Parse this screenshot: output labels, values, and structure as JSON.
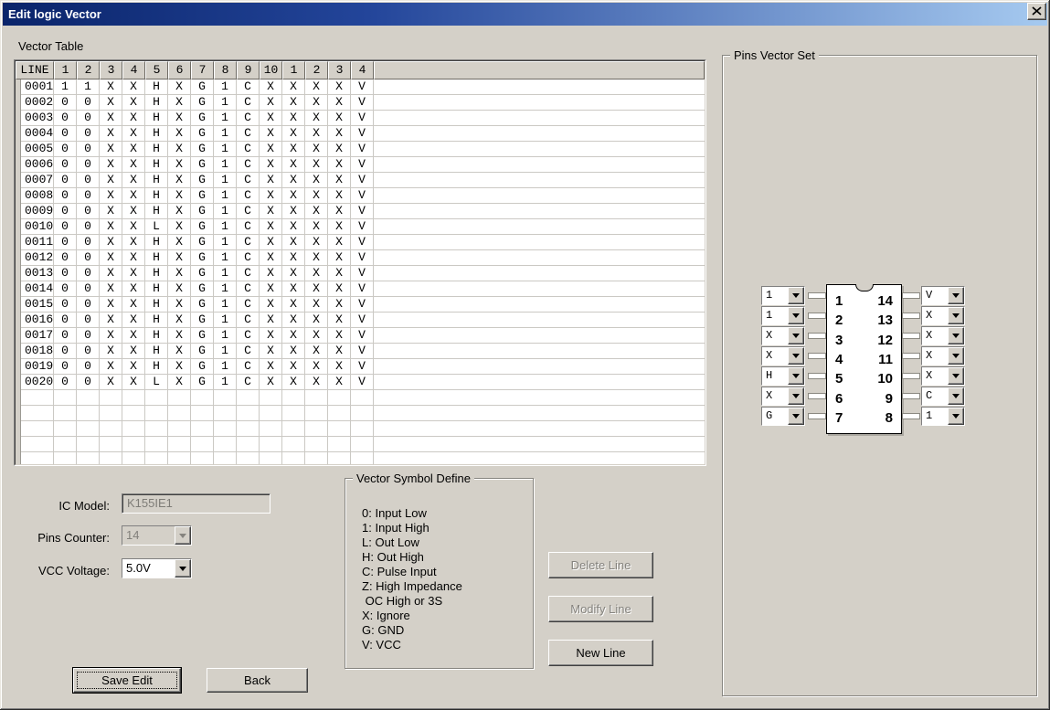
{
  "window": {
    "title": "Edit logic Vector"
  },
  "colors": {
    "dialog_bg": "#d4d0c8",
    "titlebar_start": "#0a246a",
    "titlebar_end": "#a6caf0",
    "grid_line": "#cbc9c4"
  },
  "vector_table": {
    "label": "Vector Table",
    "headers": [
      "LINE",
      "1",
      "2",
      "3",
      "4",
      "5",
      "6",
      "7",
      "8",
      "9",
      "10",
      "1",
      "2",
      "3",
      "4"
    ],
    "rows": [
      {
        "line": "0001",
        "values": [
          "1",
          "1",
          "X",
          "X",
          "H",
          "X",
          "G",
          "1",
          "C",
          "X",
          "X",
          "X",
          "X",
          "V"
        ]
      },
      {
        "line": "0002",
        "values": [
          "0",
          "0",
          "X",
          "X",
          "H",
          "X",
          "G",
          "1",
          "C",
          "X",
          "X",
          "X",
          "X",
          "V"
        ]
      },
      {
        "line": "0003",
        "values": [
          "0",
          "0",
          "X",
          "X",
          "H",
          "X",
          "G",
          "1",
          "C",
          "X",
          "X",
          "X",
          "X",
          "V"
        ]
      },
      {
        "line": "0004",
        "values": [
          "0",
          "0",
          "X",
          "X",
          "H",
          "X",
          "G",
          "1",
          "C",
          "X",
          "X",
          "X",
          "X",
          "V"
        ]
      },
      {
        "line": "0005",
        "values": [
          "0",
          "0",
          "X",
          "X",
          "H",
          "X",
          "G",
          "1",
          "C",
          "X",
          "X",
          "X",
          "X",
          "V"
        ]
      },
      {
        "line": "0006",
        "values": [
          "0",
          "0",
          "X",
          "X",
          "H",
          "X",
          "G",
          "1",
          "C",
          "X",
          "X",
          "X",
          "X",
          "V"
        ]
      },
      {
        "line": "0007",
        "values": [
          "0",
          "0",
          "X",
          "X",
          "H",
          "X",
          "G",
          "1",
          "C",
          "X",
          "X",
          "X",
          "X",
          "V"
        ]
      },
      {
        "line": "0008",
        "values": [
          "0",
          "0",
          "X",
          "X",
          "H",
          "X",
          "G",
          "1",
          "C",
          "X",
          "X",
          "X",
          "X",
          "V"
        ]
      },
      {
        "line": "0009",
        "values": [
          "0",
          "0",
          "X",
          "X",
          "H",
          "X",
          "G",
          "1",
          "C",
          "X",
          "X",
          "X",
          "X",
          "V"
        ]
      },
      {
        "line": "0010",
        "values": [
          "0",
          "0",
          "X",
          "X",
          "L",
          "X",
          "G",
          "1",
          "C",
          "X",
          "X",
          "X",
          "X",
          "V"
        ]
      },
      {
        "line": "0011",
        "values": [
          "0",
          "0",
          "X",
          "X",
          "H",
          "X",
          "G",
          "1",
          "C",
          "X",
          "X",
          "X",
          "X",
          "V"
        ]
      },
      {
        "line": "0012",
        "values": [
          "0",
          "0",
          "X",
          "X",
          "H",
          "X",
          "G",
          "1",
          "C",
          "X",
          "X",
          "X",
          "X",
          "V"
        ]
      },
      {
        "line": "0013",
        "values": [
          "0",
          "0",
          "X",
          "X",
          "H",
          "X",
          "G",
          "1",
          "C",
          "X",
          "X",
          "X",
          "X",
          "V"
        ]
      },
      {
        "line": "0014",
        "values": [
          "0",
          "0",
          "X",
          "X",
          "H",
          "X",
          "G",
          "1",
          "C",
          "X",
          "X",
          "X",
          "X",
          "V"
        ]
      },
      {
        "line": "0015",
        "values": [
          "0",
          "0",
          "X",
          "X",
          "H",
          "X",
          "G",
          "1",
          "C",
          "X",
          "X",
          "X",
          "X",
          "V"
        ]
      },
      {
        "line": "0016",
        "values": [
          "0",
          "0",
          "X",
          "X",
          "H",
          "X",
          "G",
          "1",
          "C",
          "X",
          "X",
          "X",
          "X",
          "V"
        ]
      },
      {
        "line": "0017",
        "values": [
          "0",
          "0",
          "X",
          "X",
          "H",
          "X",
          "G",
          "1",
          "C",
          "X",
          "X",
          "X",
          "X",
          "V"
        ]
      },
      {
        "line": "0018",
        "values": [
          "0",
          "0",
          "X",
          "X",
          "H",
          "X",
          "G",
          "1",
          "C",
          "X",
          "X",
          "X",
          "X",
          "V"
        ]
      },
      {
        "line": "0019",
        "values": [
          "0",
          "0",
          "X",
          "X",
          "H",
          "X",
          "G",
          "1",
          "C",
          "X",
          "X",
          "X",
          "X",
          "V"
        ]
      },
      {
        "line": "0020",
        "values": [
          "0",
          "0",
          "X",
          "X",
          "L",
          "X",
          "G",
          "1",
          "C",
          "X",
          "X",
          "X",
          "X",
          "V"
        ]
      }
    ]
  },
  "pins_vector_set": {
    "label": "Pins Vector Set",
    "left_pins": [
      {
        "pin": "1",
        "value": "1"
      },
      {
        "pin": "2",
        "value": "1"
      },
      {
        "pin": "3",
        "value": "X"
      },
      {
        "pin": "4",
        "value": "X"
      },
      {
        "pin": "5",
        "value": "H"
      },
      {
        "pin": "6",
        "value": "X"
      },
      {
        "pin": "7",
        "value": "G"
      }
    ],
    "right_pins": [
      {
        "pin": "14",
        "value": "V"
      },
      {
        "pin": "13",
        "value": "X"
      },
      {
        "pin": "12",
        "value": "X"
      },
      {
        "pin": "11",
        "value": "X"
      },
      {
        "pin": "10",
        "value": "X"
      },
      {
        "pin": "9",
        "value": "C"
      },
      {
        "pin": "8",
        "value": "1"
      }
    ]
  },
  "form": {
    "ic_model_label": "IC Model:",
    "ic_model_value": "K155IE1",
    "pins_counter_label": "Pins Counter:",
    "pins_counter_value": "14",
    "vcc_voltage_label": "VCC Voltage:",
    "vcc_voltage_value": "5.0V"
  },
  "symbol_define": {
    "label": "Vector Symbol Define",
    "lines": [
      "0: Input Low",
      "1: Input High",
      "L: Out Low",
      "H: Out High",
      "C: Pulse Input",
      "Z: High Impedance",
      " OC High or 3S",
      "X: Ignore",
      "G: GND",
      "V: VCC"
    ]
  },
  "buttons": {
    "delete_line": "Delete Line",
    "modify_line": "Modify Line",
    "new_line": "New Line",
    "save_edit": "Save Edit",
    "back": "Back"
  }
}
